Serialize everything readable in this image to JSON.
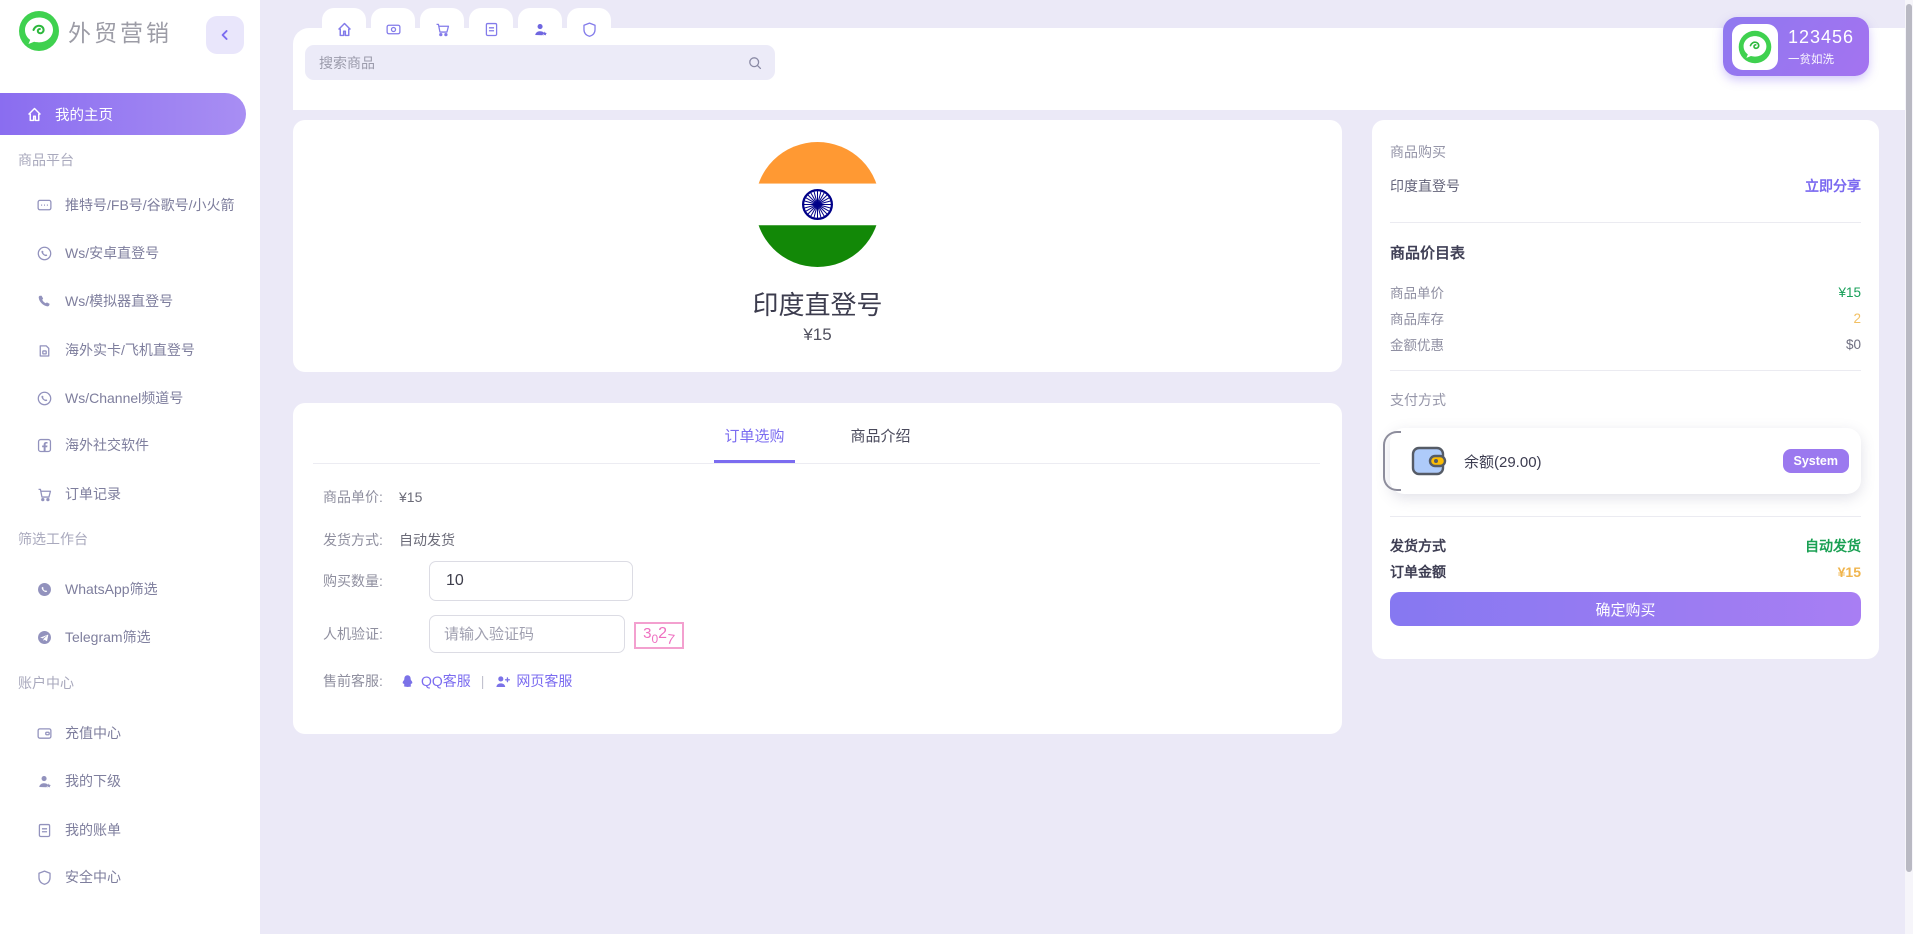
{
  "brand": {
    "name": "外贸营销"
  },
  "sidebar": {
    "home_label": "我的主页",
    "groups": [
      {
        "label": "商品平台",
        "items": [
          {
            "label": "推特号/FB号/谷歌号/小火箭"
          },
          {
            "label": "Ws/安卓直登号"
          },
          {
            "label": "Ws/模拟器直登号"
          },
          {
            "label": "海外实卡/飞机直登号"
          },
          {
            "label": "Ws/Channel频道号"
          },
          {
            "label": "海外社交软件"
          },
          {
            "label": "订单记录"
          }
        ]
      },
      {
        "label": "筛选工作台",
        "items": [
          {
            "label": "WhatsApp筛选"
          },
          {
            "label": "Telegram筛选"
          }
        ]
      },
      {
        "label": "账户中心",
        "items": [
          {
            "label": "充值中心"
          },
          {
            "label": "我的下级"
          },
          {
            "label": "我的账单"
          },
          {
            "label": "安全中心"
          }
        ]
      }
    ]
  },
  "header": {
    "search_placeholder": "搜索商品",
    "user": {
      "name": "123456",
      "tagline": "一贫如洗"
    }
  },
  "product": {
    "title": "印度直登号",
    "price": "¥15"
  },
  "order": {
    "tab_active": "订单选购",
    "tab_inactive": "商品介绍",
    "unit_price_label": "商品单价:",
    "unit_price": "¥15",
    "delivery_label": "发货方式:",
    "delivery_value": "自动发货",
    "qty_label": "购买数量:",
    "qty_value": "10",
    "captcha_label": "人机验证:",
    "captcha_placeholder": "请输入验证码",
    "captcha_chars": [
      "3",
      "0",
      "2",
      "7"
    ],
    "service_label": "售前客服:",
    "qq_link": "QQ客服",
    "service_sep": "|",
    "web_link": "网页客服"
  },
  "panel": {
    "title": "商品购买",
    "product_name": "印度直登号",
    "share_link": "立即分享",
    "pricelist_title": "商品价目表",
    "rows": [
      {
        "label": "商品单价",
        "value": "¥15"
      },
      {
        "label": "商品库存",
        "value": "2"
      },
      {
        "label": "金额优惠",
        "value": "$0"
      }
    ],
    "payment_title": "支付方式",
    "payment": {
      "name": "余额(29.00)",
      "badge": "System"
    },
    "summary": [
      {
        "label": "发货方式",
        "value": "自动发货"
      },
      {
        "label": "订单金额",
        "value": "¥15"
      }
    ],
    "buy_button": "确定购买"
  },
  "colors": {
    "accent": "#7b6cf0",
    "green": "#1aa053",
    "orange": "#f0b54e",
    "pink": "#ef6fc0",
    "badge_purple": "#9b79ef"
  }
}
